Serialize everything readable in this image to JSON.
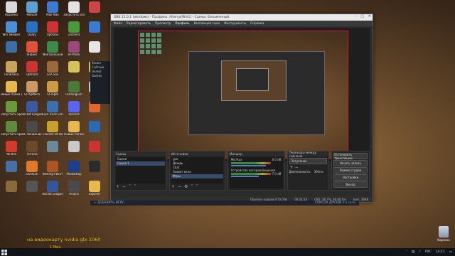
{
  "desktop": {
    "icons_col1": [
      {
        "label": "Корзина",
        "color": "#d9d9d9"
      },
      {
        "label": "Win Tweaker",
        "color": "#4a90d9"
      },
      {
        "label": "",
        "color": "#3a6ea5"
      },
      {
        "label": "Политика",
        "color": "#c8a45a"
      },
      {
        "label": "Новые папки (2)",
        "color": "#e6b84d"
      },
      {
        "label": "Запустить SpinTire",
        "color": "#6a9a3a"
      },
      {
        "label": "Запустить SpinTire",
        "color": "#5d8a3c"
      },
      {
        "label": "Yandex",
        "color": "#d23b2b"
      },
      {
        "label": "",
        "color": "#4a6fa5"
      },
      {
        "label": "",
        "color": "#8a6a3a"
      }
    ],
    "icons_col2": [
      {
        "label": "Нельзя",
        "color": "#5aa0d0"
      },
      {
        "label": "Uplay",
        "color": "#2a70c0"
      },
      {
        "label": "Яндекс",
        "color": "#e0503a"
      },
      {
        "label": "Uptrond",
        "color": "#c33"
      },
      {
        "label": "ScrapMech",
        "color": "#c96"
      },
      {
        "label": "Rocket League",
        "color": "#3a5aa0"
      },
      {
        "label": "BC Овчинник",
        "color": "#4a4a4a"
      },
      {
        "label": "Terraria",
        "color": "#6a4a2a"
      },
      {
        "label": "OnAllum",
        "color": "#e07a2a"
      },
      {
        "label": "",
        "color": "#555"
      }
    ],
    "icons_col3": [
      {
        "label": "Mail Max",
        "color": "#3a7ad0"
      },
      {
        "label": "Uptrond",
        "color": "#c33"
      },
      {
        "label": "Минтрольной",
        "color": "#3a8a4a"
      },
      {
        "label": "GTA San",
        "color": "#9a6a3a"
      },
      {
        "label": "SCrapM",
        "color": "#c94"
      },
      {
        "label": "Euro Truck Simulator 2",
        "color": "#3a70b0"
      },
      {
        "label": "Counter-Strike",
        "color": "#c8a030"
      },
      {
        "label": "",
        "color": "#6a8a9a"
      },
      {
        "label": "Nesting Рикот",
        "color": "#aa5522"
      },
      {
        "label": "Rocket League",
        "color": "#335599"
      }
    ],
    "icons_col4": [
      {
        "label": "Запустить Всегда",
        "color": "#e2e2e2"
      },
      {
        "label": "uTorrent",
        "color": "#4a9a3a"
      },
      {
        "label": "Hi-Photo",
        "color": "#9a4a7a"
      },
      {
        "label": "",
        "color": "#d6c35a"
      },
      {
        "label": "FarmingSim",
        "color": "#4a7a3a"
      },
      {
        "label": "Discord",
        "color": "#5865f2"
      },
      {
        "label": "Новые папки",
        "color": "#e6b84d"
      },
      {
        "label": "",
        "color": "#c9c9c9"
      },
      {
        "label": "Photoshop",
        "color": "#1b3f8a"
      },
      {
        "label": "Oculus",
        "color": "#4a4a4a"
      }
    ],
    "icons_col5": [
      {
        "label": "",
        "color": "#c44"
      },
      {
        "label": "",
        "color": "#3a7ad0"
      },
      {
        "label": "",
        "color": "#e6e6e6"
      },
      {
        "label": "",
        "color": "#e6b84d"
      },
      {
        "label": "",
        "color": "#c8c8c8"
      },
      {
        "label": "",
        "color": "#d63"
      },
      {
        "label": "",
        "color": "#2a6ab0"
      },
      {
        "label": "",
        "color": "#c33"
      },
      {
        "label": "",
        "color": "#2b2b2b"
      },
      {
        "label": "Explorer",
        "color": "#e6b84d"
      }
    ],
    "recycle_label": "Корзина"
  },
  "obs": {
    "title": "OBS 21.0.1 (windows) - Профиль: Alteryx(Win1) - Сцены: Безымянный",
    "menu": [
      "Файл",
      "Редактировать",
      "Просмотр",
      "Профиль",
      "Коллекция сцен",
      "Инструменты",
      "Справка"
    ],
    "panels": {
      "scenes": {
        "header": "Сцены",
        "items": [
          "Сцена",
          "Сцена 1"
        ]
      },
      "sources": {
        "header": "Источники",
        "items": [
          "урн",
          "Дождь",
          "Chat",
          "Захват окна",
          "Игры"
        ]
      },
      "mixer": {
        "header": "Микшер",
        "channels": [
          {
            "name": "Mic/Aux",
            "db": "0.0 dB"
          },
          {
            "name": "Устройство воспроизведения",
            "db": "-7.0 dB"
          }
        ]
      },
      "transitions": {
        "header": "Переходы между сценами",
        "type": "Затухание",
        "duration_label": "Длительность",
        "duration": "300ms"
      },
      "controls": {
        "buttons": [
          "Остановить трансляцию",
          "Начать запись",
          "Режим студии",
          "Настройки",
          "Выход"
        ]
      }
    },
    "status": {
      "dropped": "Пропуск кадров 0 (0.0%)",
      "time": "00:32:24",
      "cpu": "CPU: 36.7%, 60.00 fps",
      "kbps": "kb/s: 3648"
    }
  },
  "steam": {
    "items": [
      "Steam",
      "Счётчик",
      "Unreal",
      "Games"
    ],
    "add_game": "ДОБАВИТЬ ИГРУ...",
    "friends": "СПИСОК ДРУЗЕЙ",
    "friends_sub": "0 в сети"
  },
  "overlay": {
    "text": "на видеокарту nvidia gtx 1060",
    "sub": "1 Мин"
  },
  "taskbar": {
    "lang": "РУС",
    "time": "14:11"
  }
}
